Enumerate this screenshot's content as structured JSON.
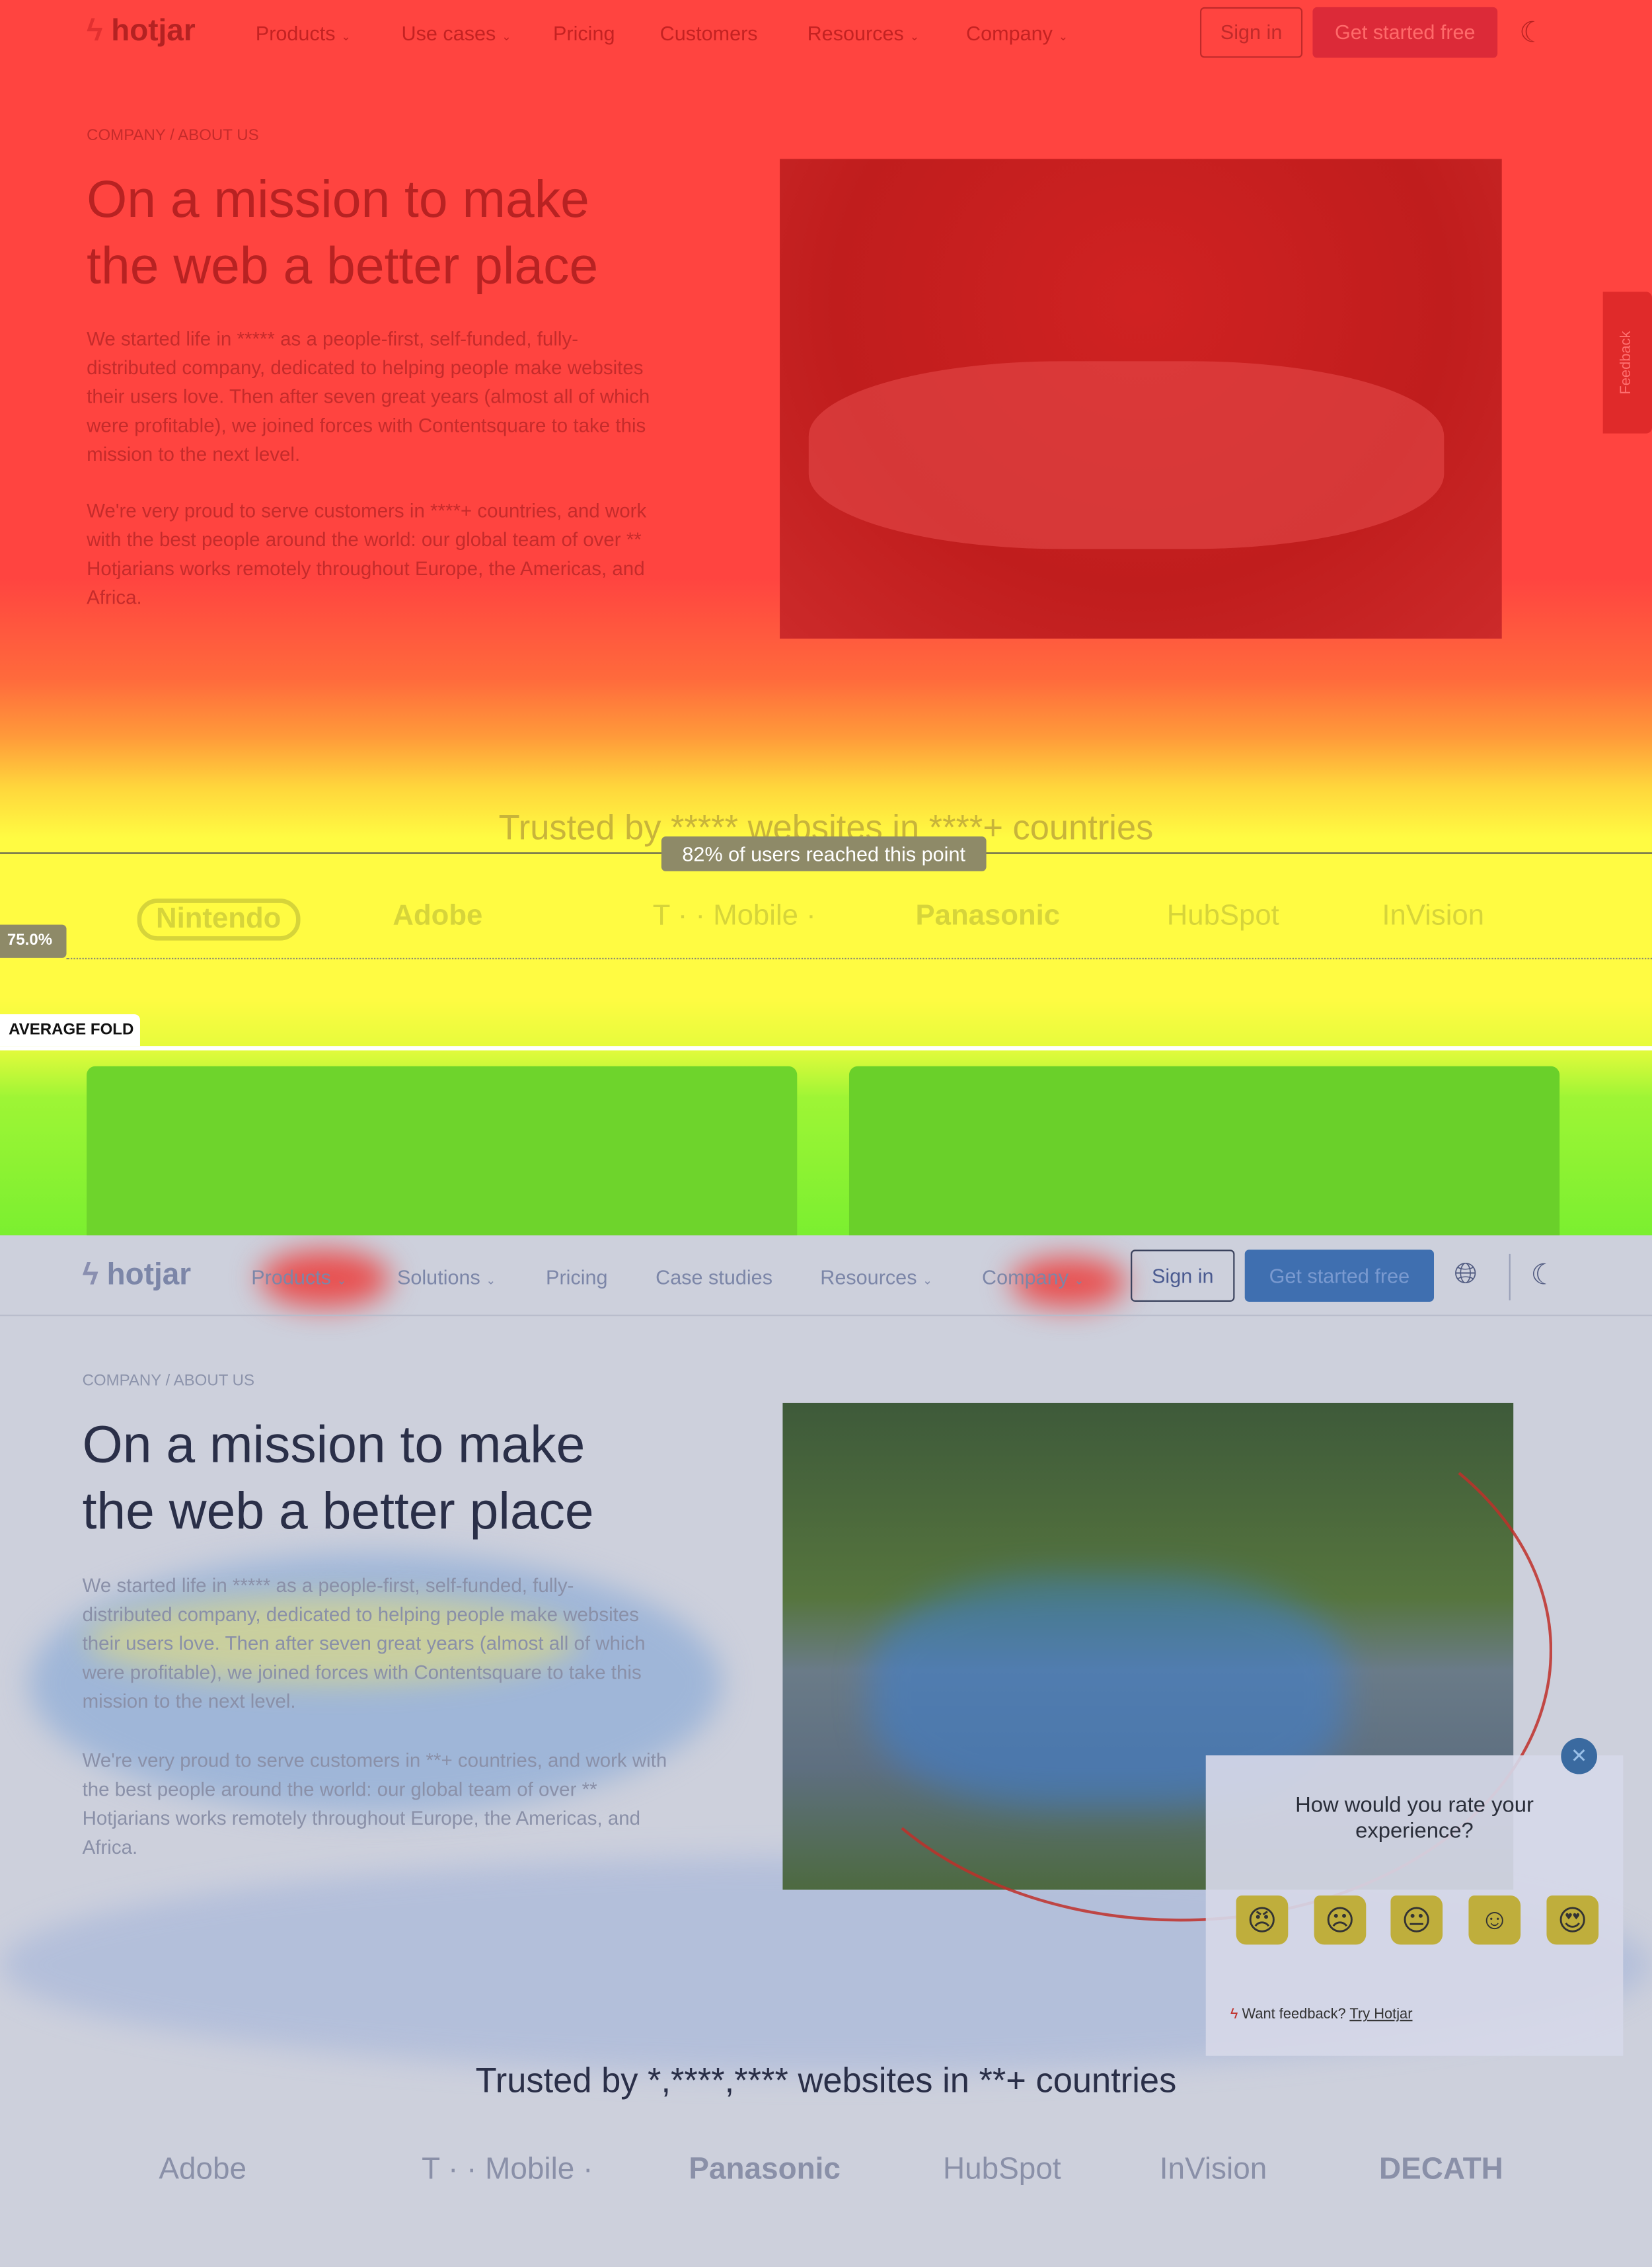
{
  "heatmap_top": {
    "nav": {
      "logo": "hotjar",
      "items": [
        {
          "label": "Products",
          "dropdown": true
        },
        {
          "label": "Use cases",
          "dropdown": true
        },
        {
          "label": "Pricing",
          "dropdown": false
        },
        {
          "label": "Customers",
          "dropdown": false
        },
        {
          "label": "Resources",
          "dropdown": true
        },
        {
          "label": "Company",
          "dropdown": true
        }
      ],
      "sign_in": "Sign in",
      "get_started": "Get started free",
      "theme_icon": "moon-icon"
    },
    "breadcrumb": "COMPANY / ABOUT US",
    "headline_line1": "On a mission to make",
    "headline_line2": "the web a better place",
    "paragraph1": "We started life in ***** as a people-first, self-funded, fully-distributed company, dedicated to helping people make websites their users love. Then after seven great years (almost all of which were profitable), we joined forces with Contentsquare to take this mission to the next level.",
    "paragraph2": "We're very proud to serve customers in ****+ countries, and work with the best people around the world: our global team of over ** Hotjarians works remotely throughout Europe, the Americas, and Africa.",
    "feedback_tab": "Feedback",
    "trusted": "Trusted by ***** websites in ****+ countries",
    "logos": [
      "Nintendo",
      "Adobe",
      "T · · Mobile ·",
      "Panasonic",
      "HubSpot",
      "InVision"
    ],
    "reach_tooltip": "82% of users reached this point",
    "scroll_percent_badge": "75.0%",
    "average_fold": "AVERAGE FOLD",
    "colors": {
      "hot": "#ff4440",
      "warm": "#fffb42",
      "cool": "#7bef30"
    }
  },
  "heatmap_bottom": {
    "nav": {
      "logo": "hotjar",
      "items": [
        {
          "label": "Products",
          "dropdown": true
        },
        {
          "label": "Solutions",
          "dropdown": true
        },
        {
          "label": "Pricing",
          "dropdown": false
        },
        {
          "label": "Case studies",
          "dropdown": false
        },
        {
          "label": "Resources",
          "dropdown": true
        },
        {
          "label": "Company",
          "dropdown": true
        }
      ],
      "sign_in": "Sign in",
      "get_started": "Get started free",
      "language_icon": "globe-icon",
      "theme_icon": "moon-icon"
    },
    "breadcrumb": "COMPANY / ABOUT US",
    "headline_line1": "On a mission to make",
    "headline_line2": "the web a better place",
    "paragraph1": "We started life in ***** as a people-first, self-funded, fully-distributed company, dedicated to helping people make websites their users love. Then after seven great years (almost all of which were profitable), we joined forces with Contentsquare to take this mission to the next level.",
    "paragraph2": "We're very proud to serve customers in **+ countries, and work with the best people around the world: our global team of over ** Hotjarians works remotely throughout Europe, the Americas, and Africa.",
    "survey": {
      "question": "How would you rate your experience?",
      "ratings": [
        "angry",
        "sad",
        "neutral",
        "happy",
        "love"
      ],
      "footer_text": "Want feedback?",
      "footer_link": "Try Hotjar"
    },
    "trusted": "Trusted by *,****,**** websites in **+ countries",
    "logos": [
      "Adobe",
      "T · · Mobile ·",
      "Panasonic",
      "HubSpot",
      "InVision",
      "DECATH"
    ]
  }
}
